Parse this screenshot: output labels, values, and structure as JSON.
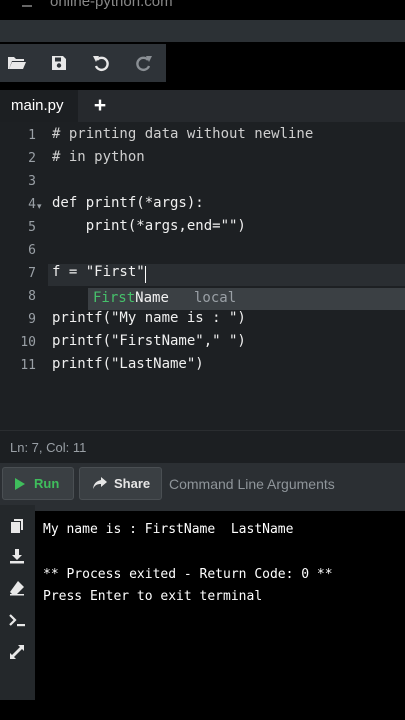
{
  "window": {
    "title": "online-python.com"
  },
  "toolbar": {
    "buttons": [
      {
        "name": "open-folder",
        "icon": "folder-open-icon"
      },
      {
        "name": "save",
        "icon": "floppy-save-icon"
      },
      {
        "name": "undo",
        "icon": "undo-icon"
      },
      {
        "name": "redo",
        "icon": "redo-icon"
      }
    ]
  },
  "tabs": {
    "active_label": "main.py",
    "add_label": "+"
  },
  "editor": {
    "line_numbers": [
      "1",
      "2",
      "3",
      "4",
      "5",
      "6",
      "7",
      "8",
      "9",
      "10",
      "11"
    ],
    "lines": [
      "# printing data without newline",
      "# in python",
      "",
      "def printf(*args):",
      "    print(*args,end=\"\")",
      "",
      "f = \"First\"",
      "",
      "printf(\"My name is : \")",
      "printf(\"FirstName\",\" \")",
      "printf(\"LastName\")"
    ],
    "fold_marker": "▾",
    "autocomplete": {
      "match": "First",
      "rest": "Name",
      "type": "local"
    }
  },
  "status": {
    "position": "Ln: 7,  Col: 11"
  },
  "runbar": {
    "run_label": "Run",
    "share_label": "Share",
    "args_placeholder": "Command Line Arguments"
  },
  "terminal": {
    "lines": [
      "My name is : FirstName  LastName",
      "",
      "** Process exited - Return Code: 0 **",
      "Press Enter to exit terminal"
    ]
  },
  "colors": {
    "accent_green": "#3fbe5c",
    "editor_bg": "#1d2023",
    "terminal_bg": "#000000"
  }
}
